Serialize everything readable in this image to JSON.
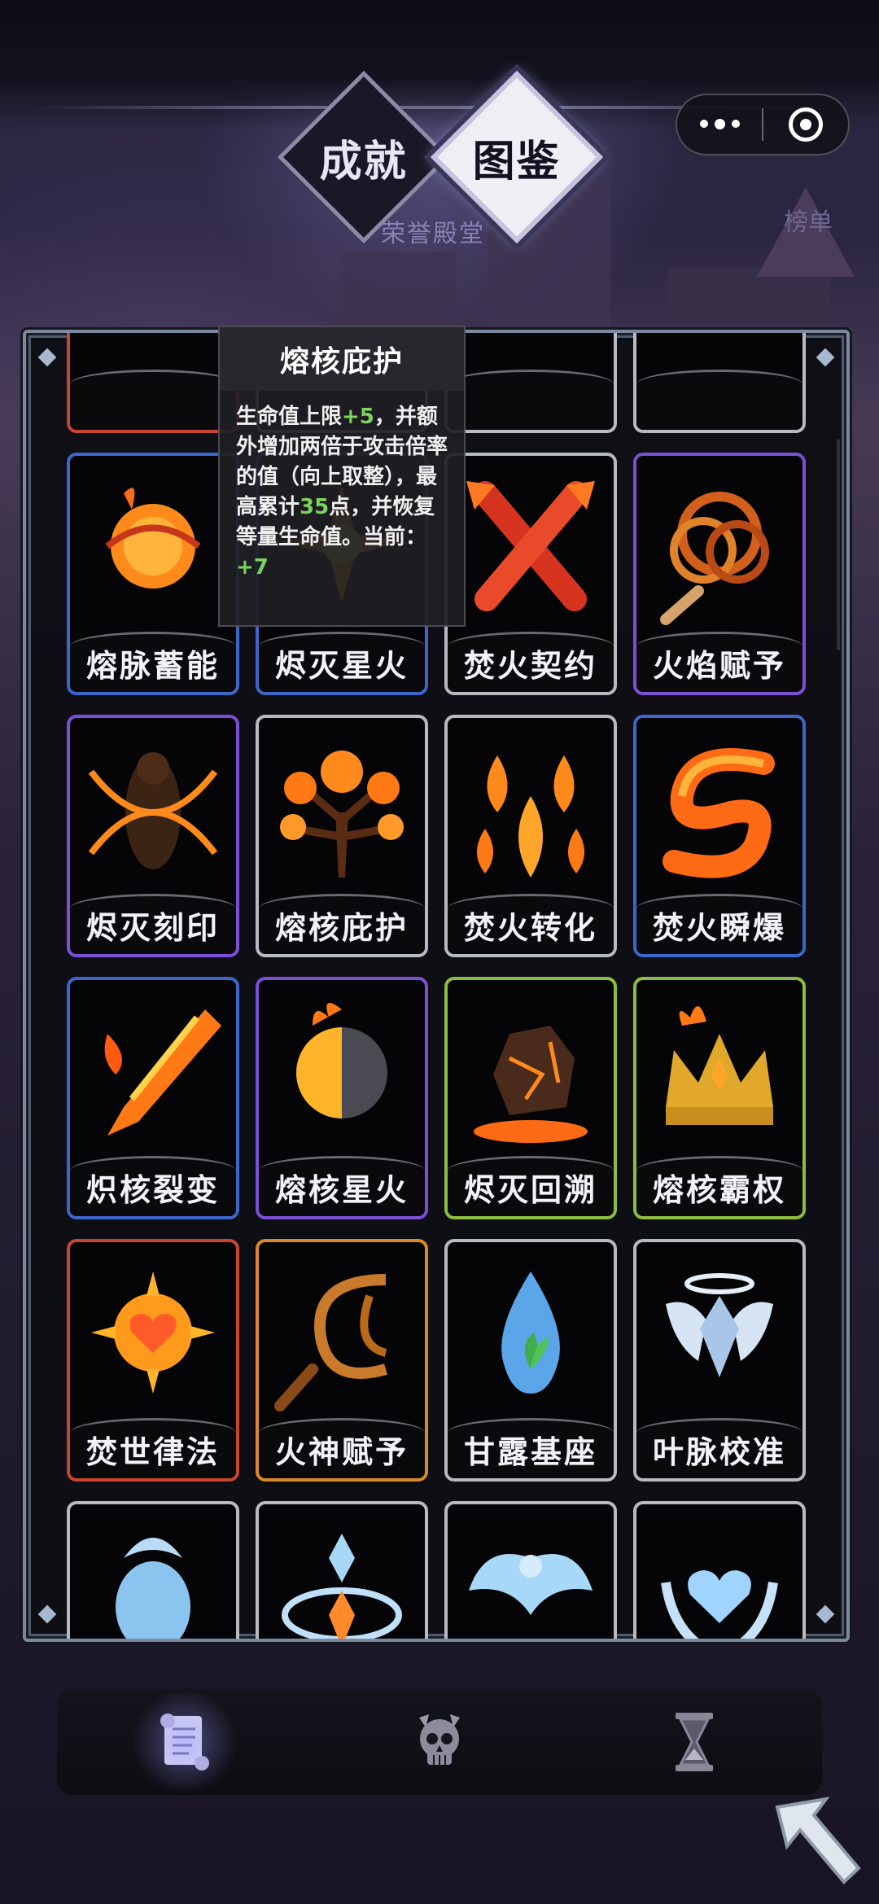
{
  "header": {
    "tabs": [
      {
        "label": "成就",
        "active": false
      },
      {
        "label": "图鉴",
        "active": true
      }
    ],
    "hall_label": "荣誉殿堂",
    "list_label": "榜单"
  },
  "tooltip": {
    "title": "熔核庇护",
    "line_parts": [
      {
        "text": "生命值上限",
        "hl": false
      },
      {
        "text": "+5",
        "hl": true
      },
      {
        "text": "，并额外增加两倍于攻击倍率的值（向上取整），最高累计",
        "hl": false
      },
      {
        "text": "35",
        "hl": true
      },
      {
        "text": "点，并恢复等量生命值。当前：",
        "hl": false
      },
      {
        "text": "+7",
        "hl": true
      }
    ]
  },
  "codex": {
    "rows": [
      [
        {
          "label": "",
          "color": "red",
          "icon": "partial-icon"
        },
        {
          "label": "",
          "color": "gray",
          "icon": "partial-icon"
        },
        {
          "label": "",
          "color": "gray",
          "icon": "partial-icon"
        },
        {
          "label": "",
          "color": "gray",
          "icon": "partial-icon"
        }
      ],
      [
        {
          "label": "熔脉蓄能",
          "color": "blue",
          "icon": "fire-planet-icon"
        },
        {
          "label": "烬灭星火",
          "color": "blue",
          "icon": "star-fire-icon"
        },
        {
          "label": "焚火契约",
          "color": "gray",
          "icon": "crossed-arrows-icon"
        },
        {
          "label": "火焰赋予",
          "color": "purple",
          "icon": "fire-whip-knot-icon"
        }
      ],
      [
        {
          "label": "烬灭刻印",
          "color": "purple",
          "icon": "chained-figure-icon"
        },
        {
          "label": "熔核庇护",
          "color": "gray",
          "icon": "fire-tree-icon"
        },
        {
          "label": "焚火转化",
          "color": "gray",
          "icon": "fire-spirits-icon"
        },
        {
          "label": "焚火瞬爆",
          "color": "blue",
          "icon": "fire-swirl-icon"
        }
      ],
      [
        {
          "label": "炽核裂变",
          "color": "blue",
          "icon": "flame-blade-icon"
        },
        {
          "label": "熔核星火",
          "color": "purple",
          "icon": "half-sun-icon"
        },
        {
          "label": "烬灭回溯",
          "color": "green",
          "icon": "magma-rock-icon"
        },
        {
          "label": "熔核霸权",
          "color": "green",
          "icon": "flame-crown-icon"
        }
      ],
      [
        {
          "label": "焚世律法",
          "color": "red",
          "icon": "sun-heart-icon"
        },
        {
          "label": "火神赋予",
          "color": "orange",
          "icon": "chain-whip-icon"
        },
        {
          "label": "甘露基座",
          "color": "gray",
          "icon": "water-drop-leaf-icon"
        },
        {
          "label": "叶脉校准",
          "color": "gray",
          "icon": "winged-crystal-icon"
        }
      ],
      [
        {
          "label": "",
          "color": "gray",
          "icon": "ice-spirit-icon"
        },
        {
          "label": "",
          "color": "gray",
          "icon": "ice-potion-icon"
        },
        {
          "label": "",
          "color": "gray",
          "icon": "ice-phoenix-icon"
        },
        {
          "label": "",
          "color": "gray",
          "icon": "ice-heart-hands-icon"
        }
      ]
    ]
  },
  "bottom_nav": [
    {
      "icon": "scroll-icon",
      "active": true
    },
    {
      "icon": "skull-icon",
      "active": false
    },
    {
      "icon": "hourglass-icon",
      "active": false
    }
  ],
  "colors": {
    "fire": "#ff8a1c",
    "ice": "#9fd4ff",
    "highlight": "#7dd45a"
  }
}
